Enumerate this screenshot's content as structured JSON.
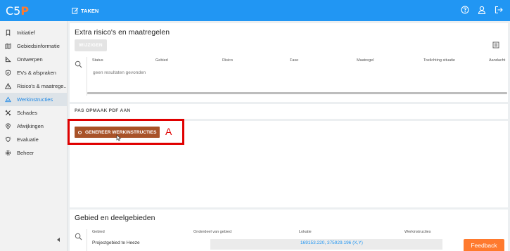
{
  "app": {
    "logo_text": "C5",
    "logo_accent": "P",
    "brand_color": "#2196f3",
    "accent_color": "#ff7a2e"
  },
  "topnav": {
    "taken_label": "TAKEN",
    "icons": [
      "help-icon",
      "user-icon",
      "logout-icon"
    ]
  },
  "sidebar": {
    "items": [
      {
        "label": "Initiatief",
        "icon": "bookmark-icon"
      },
      {
        "label": "Gebiedsinformatie",
        "icon": "map-icon"
      },
      {
        "label": "Ontwerpen",
        "icon": "ruler-icon"
      },
      {
        "label": "EVs & afspraken",
        "icon": "shield-icon"
      },
      {
        "label": "Risico's & maatrege...",
        "icon": "warning-icon"
      },
      {
        "label": "Werkinstructies",
        "icon": "triangle-icon",
        "active": true
      },
      {
        "label": "Schades",
        "icon": "tools-icon"
      },
      {
        "label": "Afwijkingen",
        "icon": "pin-icon"
      },
      {
        "label": "Evaluatie",
        "icon": "bulb-icon"
      },
      {
        "label": "Beheer",
        "icon": "gear-icon"
      }
    ]
  },
  "risico_card": {
    "title": "Extra risico's en maatregelen",
    "edit_button": "WIJZIGEN",
    "columns": [
      "Status",
      "Gebied",
      "Risico",
      "Fase",
      "Maatregel",
      "Toelichting situatie",
      "Aandacht"
    ],
    "empty_text": "geen resultaten gevonden"
  },
  "pdf_card": {
    "label": "PAS OPMAAK PDF AAN"
  },
  "generate_card": {
    "button_label": "GENEREER WERKINSTRUCTIES"
  },
  "annotation": {
    "label": "A",
    "color": "#e00000"
  },
  "gebied_card": {
    "title": "Gebied en deelgebieden",
    "columns": [
      "Gebied",
      "Onderdeel van gebied",
      "Lokatie",
      "Werkinstructies"
    ],
    "rows": [
      {
        "gebied": "Projectgebied te Heeze",
        "onderdeel": "",
        "lokatie": "169153.220, 375929.196 (X,Y)",
        "werkinstructies": ""
      }
    ]
  },
  "feedback": {
    "label": "Feedback"
  }
}
